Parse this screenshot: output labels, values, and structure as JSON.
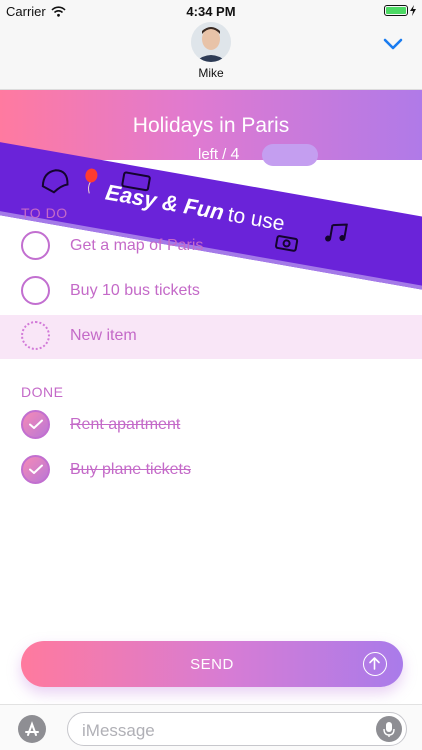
{
  "status_bar": {
    "carrier": "Carrier",
    "time": "4:34 PM",
    "battery_level": 1.0
  },
  "contact": {
    "name": "Mike",
    "avatar_icon": "person-avatar"
  },
  "list": {
    "title": "Holidays in Paris",
    "counter_label": "left /",
    "counter_total": "4"
  },
  "banner": {
    "strong_text": "Easy & Fun",
    "rest_text": "to use"
  },
  "todo_section": {
    "label": "TO DO",
    "items": [
      {
        "label": "Get a map of Paris",
        "checked": false
      },
      {
        "label": "Buy 10 bus tickets",
        "checked": false
      }
    ],
    "new_item_placeholder": "New item"
  },
  "done_section": {
    "label": "DONE",
    "items": [
      {
        "label": "Rent apartment",
        "checked": true
      },
      {
        "label": "Buy plane tickets",
        "checked": true
      }
    ]
  },
  "send_button": {
    "label": "SEND",
    "icon": "arrow-up-icon"
  },
  "imessage": {
    "placeholder": "iMessage"
  },
  "colors": {
    "accent": "#c46ac8",
    "gradient_start": "#ff7aa0",
    "gradient_end": "#b07ae8",
    "banner": "#6a23d9"
  }
}
